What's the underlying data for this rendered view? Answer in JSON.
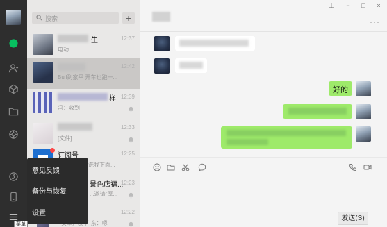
{
  "sidebar": {
    "icons": [
      "avatar",
      "chat-icon",
      "contacts-icon",
      "favorites-icon",
      "files-icon",
      "moments-icon",
      "miniprogram-icon",
      "phone-icon",
      "menu-icon"
    ]
  },
  "search": {
    "placeholder": "搜索",
    "add_label": "+"
  },
  "chats": [
    {
      "name": "生",
      "preview": "电动",
      "time": "12:37"
    },
    {
      "name": "",
      "preview": "Bull到家平  开车也跑一...",
      "time": "12:42"
    },
    {
      "name": "样",
      "preview": "冯：收到",
      "time": "12:39"
    },
    {
      "name": "",
      "preview": "[文件]",
      "time": "12:33"
    },
    {
      "name": "订阅号",
      "preview": "洗我下面...",
      "time": "12:25"
    },
    {
      "name": "景色店福...",
      "preview": "...邀请\"厚...",
      "time": "12:23"
    },
    {
      "name": "",
      "preview": "安卓开发·广东：嗯",
      "time": "12:22"
    }
  ],
  "menu": {
    "items": [
      "意见反馈",
      "备份与恢复",
      "设置"
    ],
    "tooltip": "菜单"
  },
  "window": {
    "pin": "⊥",
    "minimize": "−",
    "maximize": "□",
    "close": "×",
    "more": "···"
  },
  "messages": [
    {
      "side": "left",
      "text": ""
    },
    {
      "side": "left",
      "text": ""
    },
    {
      "side": "right",
      "text": "好的"
    },
    {
      "side": "right",
      "text": ""
    },
    {
      "side": "right",
      "text": ""
    }
  ],
  "composer": {
    "send_label": "发送(S)"
  },
  "colors": {
    "rail": "#2e2e2e",
    "list": "#e9e8e7",
    "active_chat": "#cac8c6",
    "bubble_self": "#9eea6a",
    "accent": "#07c160"
  }
}
